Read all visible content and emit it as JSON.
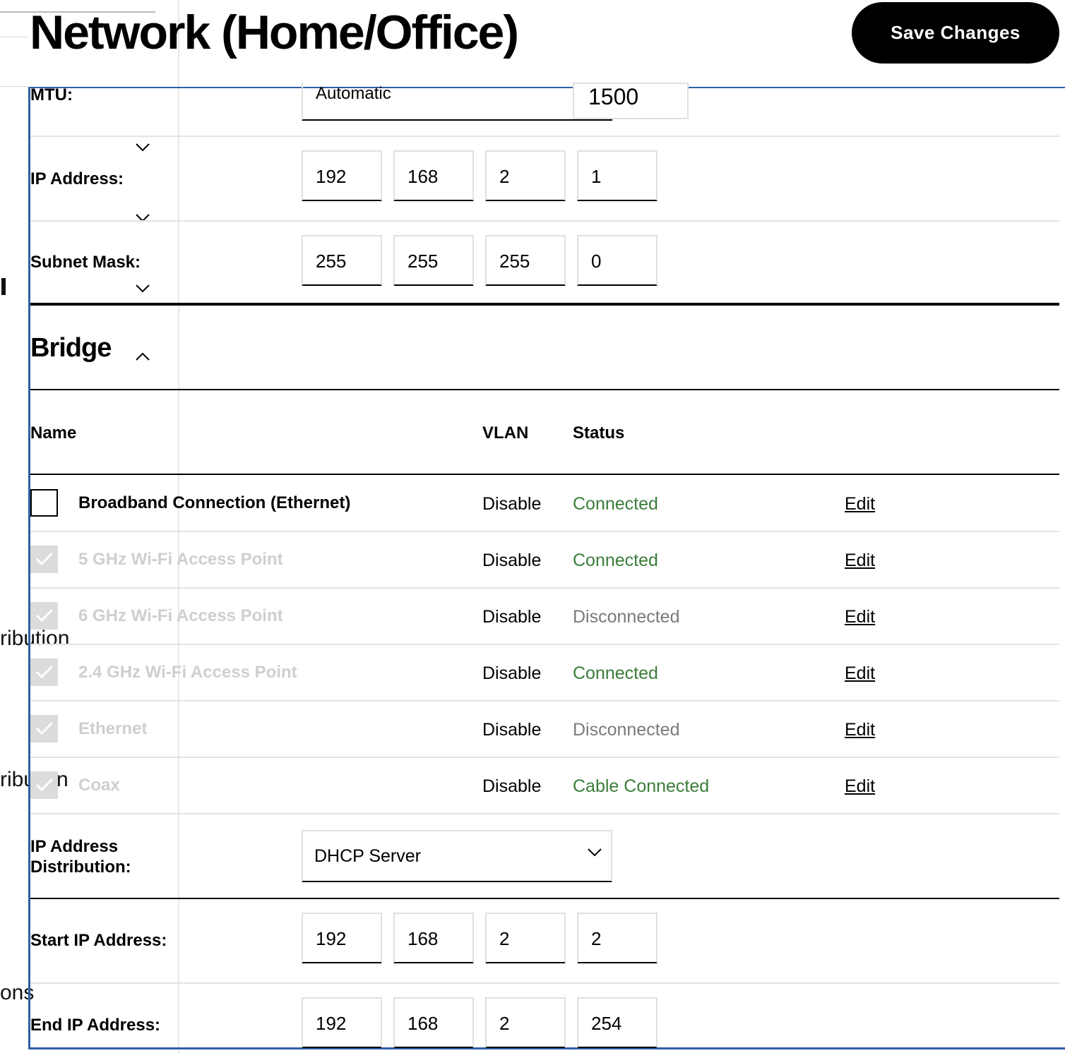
{
  "header": {
    "title": "Network (Home/Office)",
    "save_label": "Save Changes"
  },
  "background_fragments": [
    "ribution",
    "ribu",
    "n",
    "ons"
  ],
  "mtu": {
    "label": "MTU:",
    "mode": "Automatic",
    "value": "1500"
  },
  "ip_address": {
    "label": "IP Address:",
    "octets": [
      "192",
      "168",
      "2",
      "1"
    ]
  },
  "subnet_mask": {
    "label": "Subnet Mask:",
    "octets": [
      "255",
      "255",
      "255",
      "0"
    ]
  },
  "bridge": {
    "title": "Bridge",
    "columns": {
      "name": "Name",
      "vlan": "VLAN",
      "status": "Status"
    },
    "rows": [
      {
        "name": "Broadband Connection (Ethernet)",
        "vlan": "Disable",
        "status": "Connected",
        "edit": "Edit",
        "checked": false
      },
      {
        "name": "5 GHz Wi-Fi Access Point",
        "vlan": "Disable",
        "status": "Connected",
        "edit": "Edit",
        "checked": true
      },
      {
        "name": "6 GHz Wi-Fi Access Point",
        "vlan": "Disable",
        "status": "Disconnected",
        "edit": "Edit",
        "checked": true
      },
      {
        "name": "2.4 GHz Wi-Fi Access Point",
        "vlan": "Disable",
        "status": "Connected",
        "edit": "Edit",
        "checked": true
      },
      {
        "name": "Ethernet",
        "vlan": "Disable",
        "status": "Disconnected",
        "edit": "Edit",
        "checked": true
      },
      {
        "name": "Coax",
        "vlan": "Disable",
        "status": "Cable Connected",
        "edit": "Edit",
        "checked": true
      }
    ]
  },
  "distribution": {
    "label_line1": "IP Address",
    "label_line2": "Distribution:",
    "value": "DHCP Server"
  },
  "start_ip": {
    "label": "Start IP Address:",
    "octets": [
      "192",
      "168",
      "2",
      "2"
    ]
  },
  "end_ip": {
    "label": "End IP Address:",
    "octets": [
      "192",
      "168",
      "2",
      "254"
    ]
  },
  "colors": {
    "accent_border": "#2f5fa7",
    "status_connected": "#3b7d3b",
    "status_disconnected": "#7a7a7a",
    "disabled_text": "#cfcfcf"
  }
}
